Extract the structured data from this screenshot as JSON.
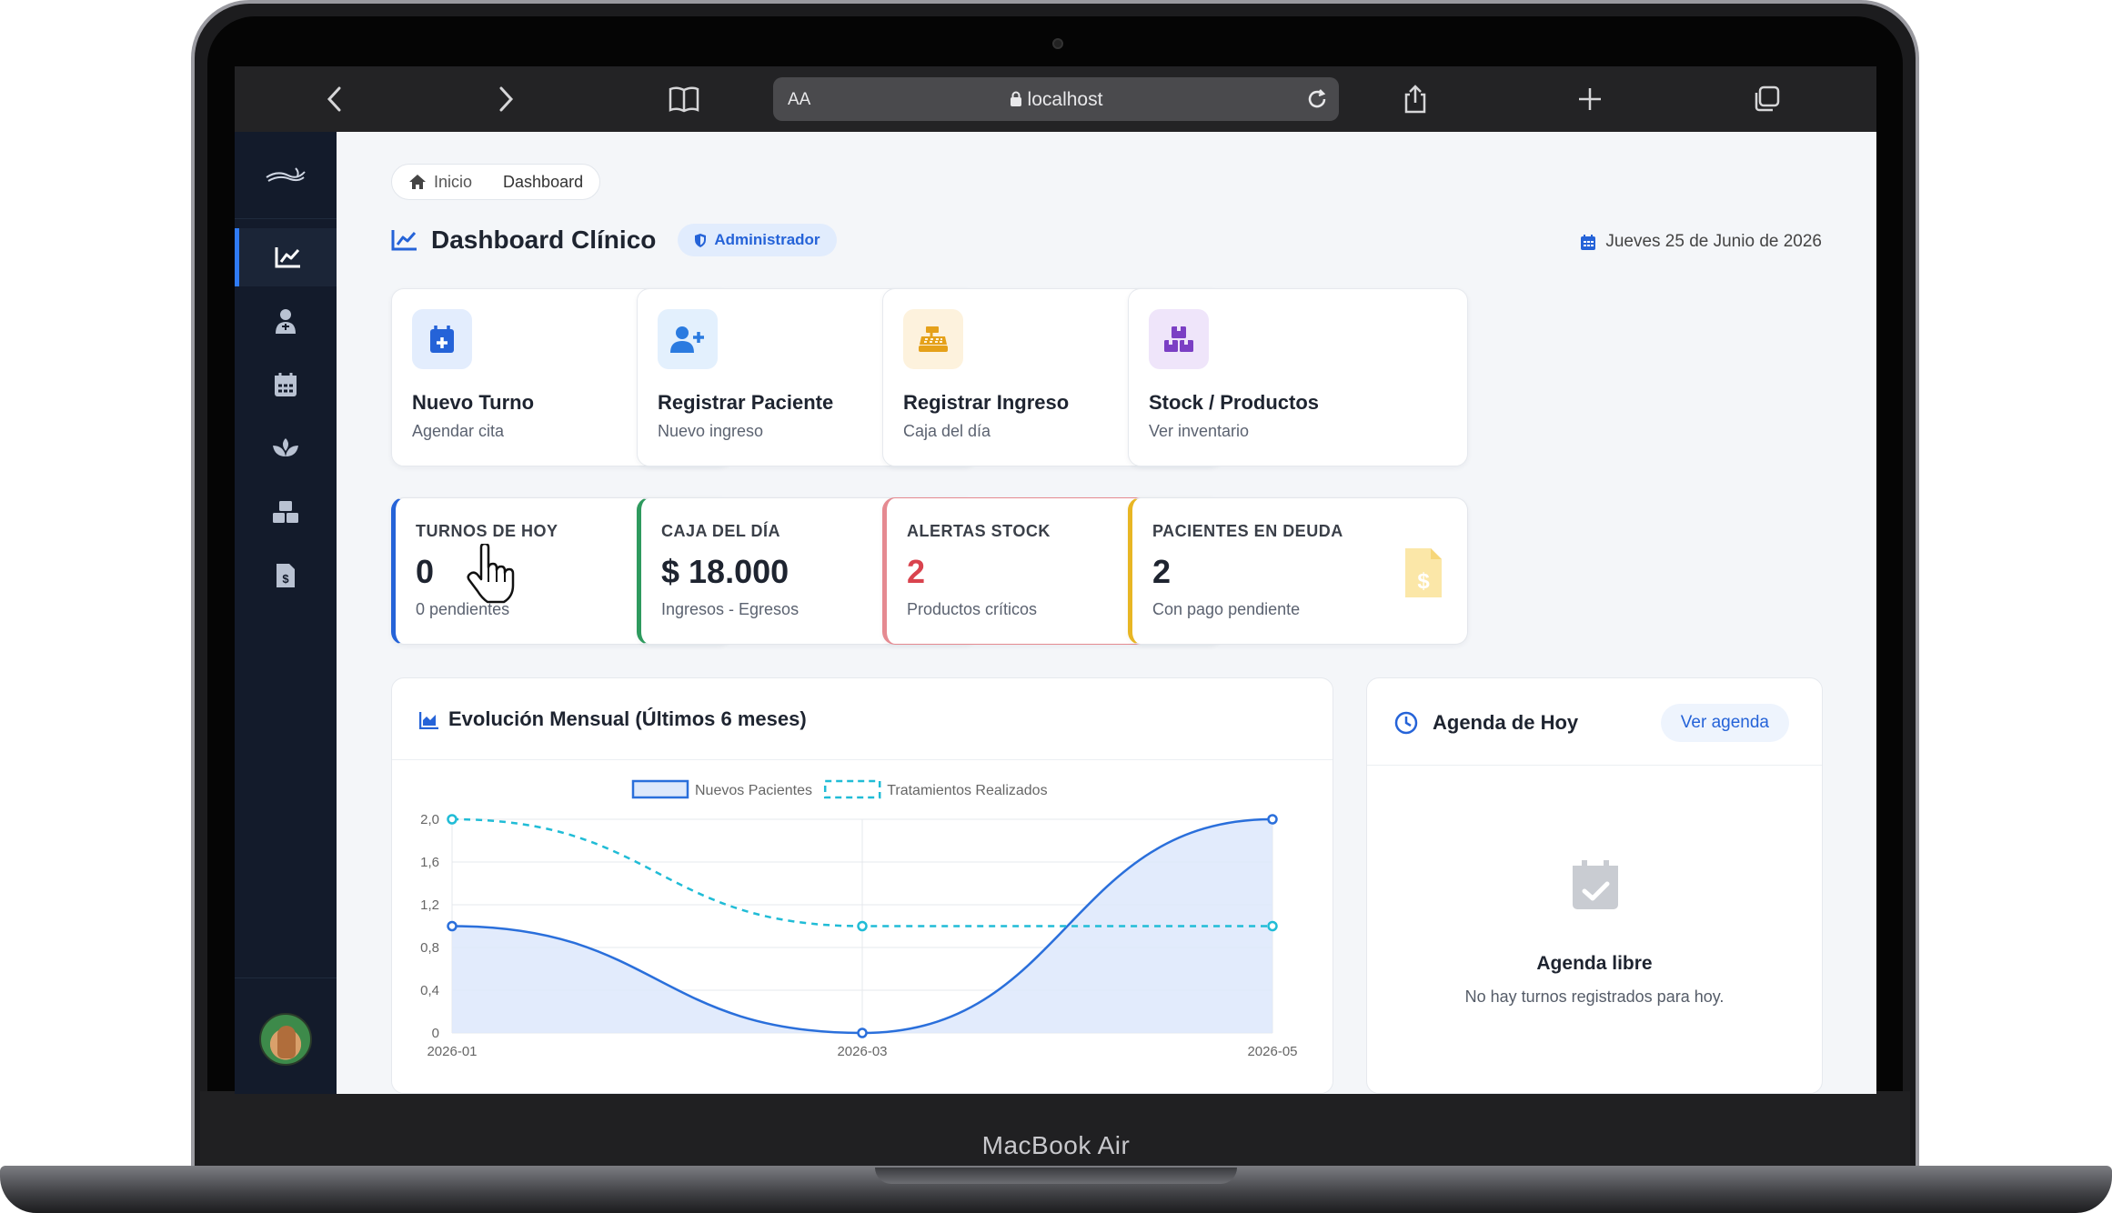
{
  "device": {
    "brand": "MacBook Air"
  },
  "browser": {
    "text_size_label": "AA",
    "address": "localhost",
    "icons": [
      "back-icon",
      "forward-icon",
      "bookmarks-icon",
      "lock-icon",
      "reload-icon",
      "share-icon",
      "new-tab-icon",
      "tabs-icon"
    ]
  },
  "sidebar": {
    "items": [
      {
        "icon": "chart-line-icon",
        "active": true
      },
      {
        "icon": "user-doctor-icon",
        "active": false
      },
      {
        "icon": "calendar-icon",
        "active": false
      },
      {
        "icon": "spa-icon",
        "active": false
      },
      {
        "icon": "boxes-icon",
        "active": false
      },
      {
        "icon": "file-invoice-dollar-icon",
        "active": false
      }
    ]
  },
  "breadcrumb": {
    "home": "Inicio",
    "current": "Dashboard"
  },
  "header": {
    "title": "Dashboard Clínico",
    "role": "Administrador",
    "date": "Jueves 25 de Junio de 2026"
  },
  "quick_actions": [
    {
      "title": "Nuevo Turno",
      "subtitle": "Agendar cita",
      "icon": "calendar-plus-icon",
      "color": "#2563d8",
      "bg": "#e3edfd"
    },
    {
      "title": "Registrar Paciente",
      "subtitle": "Nuevo ingreso",
      "icon": "user-plus-icon",
      "color": "#2b7be0",
      "bg": "#e3f0fd"
    },
    {
      "title": "Registrar Ingreso",
      "subtitle": "Caja del día",
      "icon": "cash-register-icon",
      "color": "#e5a11a",
      "bg": "#fdf2dd"
    },
    {
      "title": "Stock / Productos",
      "subtitle": "Ver inventario",
      "icon": "boxes-icon",
      "color": "#7b3fc4",
      "bg": "#efe5fa"
    }
  ],
  "stats": [
    {
      "label": "TURNOS DE HOY",
      "value": "0",
      "sub": "0 pendientes",
      "accent": "#2563d8",
      "icon": "calendar-icon"
    },
    {
      "label": "CAJA DEL DÍA",
      "value": "$ 18.000",
      "sub": "Ingresos - Egresos",
      "accent": "#2e9a5e",
      "icon": "cash-register-icon"
    },
    {
      "label": "ALERTAS STOCK",
      "value": "2",
      "sub": "Productos críticos",
      "accent": "#d9434e",
      "icon": "warning-icon"
    },
    {
      "label": "PACIENTES EN DEUDA",
      "value": "2",
      "sub": "Con pago pendiente",
      "accent": "#e8b624",
      "icon": "file-invoice-dollar-icon"
    }
  ],
  "chart_section": {
    "title": "Evolución Mensual (Últimos 6 meses)"
  },
  "chart_data": {
    "type": "line",
    "x": [
      "2026-01",
      "2026-03",
      "2026-05"
    ],
    "series": [
      {
        "name": "Nuevos Pacientes",
        "values": [
          1,
          0,
          2
        ],
        "color": "#2a6fdb",
        "fill": true,
        "dashed": false
      },
      {
        "name": "Tratamientos Realizados",
        "values": [
          2,
          1,
          1
        ],
        "color": "#20bcd6",
        "fill": false,
        "dashed": true
      }
    ],
    "ylim": [
      0,
      2
    ],
    "yticks": [
      "0",
      "0,4",
      "0,8",
      "1,2",
      "1,6",
      "2,0"
    ],
    "grid": true,
    "legend": "top"
  },
  "agenda": {
    "title": "Agenda de Hoy",
    "button": "Ver agenda",
    "empty_title": "Agenda libre",
    "empty_text": "No hay turnos registrados para hoy."
  }
}
